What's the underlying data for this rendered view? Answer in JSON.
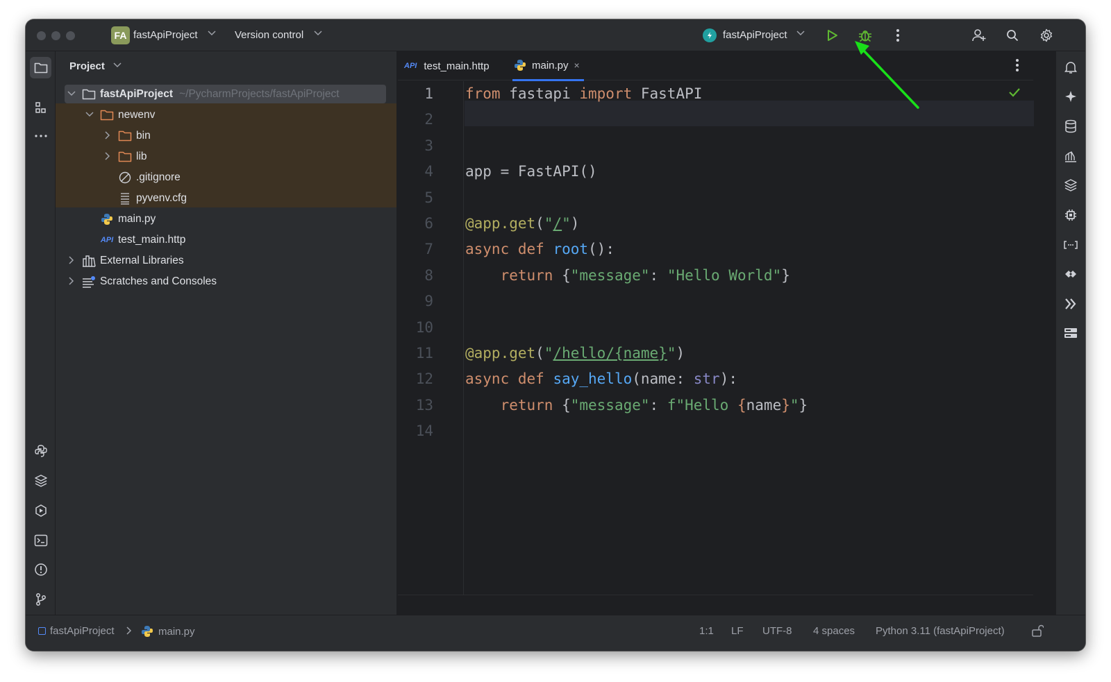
{
  "titlebar": {
    "project_badge": "FA",
    "project_name": "fastApiProject",
    "vcs_label": "Version control",
    "run_config": "fastApiProject",
    "icons": [
      "run-icon",
      "debug-icon",
      "more-vertical-icon",
      "add-user-icon",
      "search-icon",
      "settings-icon"
    ]
  },
  "project_panel": {
    "title": "Project",
    "tree": [
      {
        "label": "fastApiProject",
        "path": "~/PycharmProjects/fastApiProject",
        "icon": "folder-icon",
        "expanded": true
      },
      {
        "label": "newenv",
        "icon": "folder-icon",
        "expanded": true,
        "excluded": true
      },
      {
        "label": "bin",
        "icon": "folder-icon",
        "expanded": false,
        "excluded": true
      },
      {
        "label": "lib",
        "icon": "folder-icon",
        "expanded": false,
        "excluded": true
      },
      {
        "label": ".gitignore",
        "icon": "ignore-file-icon",
        "excluded": true
      },
      {
        "label": "pyvenv.cfg",
        "icon": "config-file-icon",
        "excluded": true
      },
      {
        "label": "main.py",
        "icon": "python-file-icon"
      },
      {
        "label": "test_main.http",
        "icon": "http-file-icon",
        "badge": "API"
      },
      {
        "label": "External Libraries",
        "icon": "libraries-icon",
        "expanded": false
      },
      {
        "label": "Scratches and Consoles",
        "icon": "scratches-icon",
        "expanded": false
      }
    ]
  },
  "editor": {
    "tabs": [
      {
        "label": "test_main.http",
        "badge": "API",
        "active": false
      },
      {
        "label": "main.py",
        "active": true,
        "close": "×"
      }
    ],
    "line_numbers": [
      "1",
      "2",
      "3",
      "4",
      "5",
      "6",
      "7",
      "8",
      "9",
      "10",
      "11",
      "12",
      "13",
      "14"
    ],
    "current_line": 1
  },
  "status_bar": {
    "breadcrumb_project": "fastApiProject",
    "breadcrumb_file": "main.py",
    "position": "1:1",
    "line_separator": "LF",
    "encoding": "UTF-8",
    "indent": "4 spaces",
    "interpreter": "Python 3.11 (fastApiProject)"
  },
  "colors": {
    "keyword": "#cf8e6d",
    "decorator": "#b3ae60",
    "string": "#6aab73",
    "function": "#56a8f5",
    "builtin": "#8888c6",
    "run_green": "#5fb832",
    "annotation_arrow": "#19e019",
    "excluded_bg": "#3d3223"
  }
}
